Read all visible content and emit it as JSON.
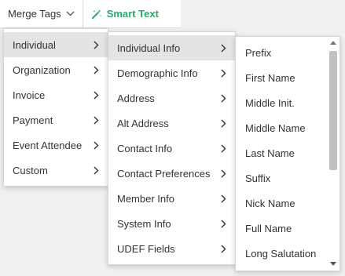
{
  "toolbar": {
    "merge_tags_label": "Merge Tags",
    "smart_text_label": "Smart Text"
  },
  "menu_level1": [
    {
      "label": "Individual"
    },
    {
      "label": "Organization"
    },
    {
      "label": "Invoice"
    },
    {
      "label": "Payment"
    },
    {
      "label": "Event Attendee"
    },
    {
      "label": "Custom"
    }
  ],
  "menu_level2": [
    {
      "label": "Individual Info"
    },
    {
      "label": "Demographic Info"
    },
    {
      "label": "Address"
    },
    {
      "label": "Alt Address"
    },
    {
      "label": "Contact Info"
    },
    {
      "label": "Contact Preferences"
    },
    {
      "label": "Member Info"
    },
    {
      "label": "System Info"
    },
    {
      "label": "UDEF Fields"
    }
  ],
  "menu_level3": [
    {
      "label": "Prefix"
    },
    {
      "label": "First Name"
    },
    {
      "label": "Middle Init."
    },
    {
      "label": "Middle Name"
    },
    {
      "label": "Last Name"
    },
    {
      "label": "Suffix"
    },
    {
      "label": "Nick Name"
    },
    {
      "label": "Full Name"
    },
    {
      "label": "Long Salutation"
    }
  ],
  "colors": {
    "smart_text_accent": "#16b26d",
    "active_item_bg": "#e4e4e4"
  },
  "icons": {
    "merge_tags": "chevron-down-icon",
    "smart_text": "magic-wand-icon",
    "submenu": "chevron-right-icon"
  }
}
